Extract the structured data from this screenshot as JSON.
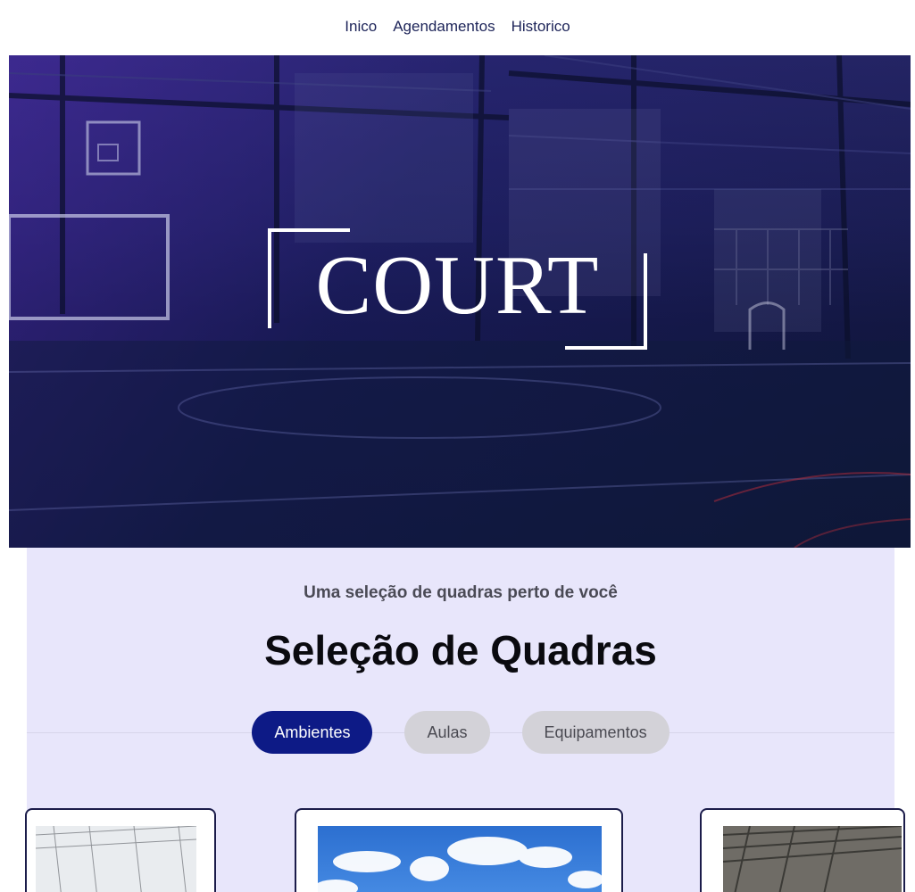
{
  "nav": {
    "items": [
      {
        "label": "Inico"
      },
      {
        "label": "Agendamentos"
      },
      {
        "label": "Historico"
      }
    ]
  },
  "hero": {
    "logo_text": "COURT"
  },
  "section": {
    "subtitle": "Uma seleção de quadras perto de você",
    "title": "Seleção de Quadras",
    "tabs": [
      {
        "label": "Ambientes",
        "active": true
      },
      {
        "label": "Aulas",
        "active": false
      },
      {
        "label": "Equipamentos",
        "active": false
      }
    ]
  },
  "colors": {
    "nav_text": "#1c2358",
    "tab_active": "#0d1a86",
    "tab_inactive": "#d3d2d8",
    "section_bg": "#e8e6fb"
  }
}
